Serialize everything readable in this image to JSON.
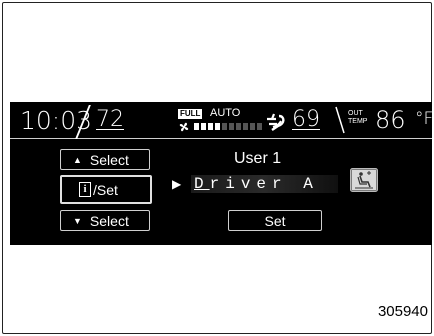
{
  "status_bar": {
    "clock": "10:03",
    "left_temp": "72",
    "fan_mode_badge": "FULL",
    "fan_auto_label": "AUTO",
    "fan_level_fraction": 0.4,
    "right_temp": "69",
    "outside_label_line1": "OUT",
    "outside_label_line2": "TEMP",
    "outside_temp": "86",
    "outside_unit": "°F",
    "icons": [
      "fan-icon",
      "airflow-icon"
    ]
  },
  "controls": {
    "select_up_label": "Select",
    "info_set_icon": "i",
    "info_set_label": "/Set",
    "select_down_label": "Select",
    "arrow_up": "▲",
    "arrow_down": "▼"
  },
  "main": {
    "user_title": "User 1",
    "driver_arrow": "▶",
    "driver_name": "Driver A",
    "set_label": "Set",
    "seat_icon": "seat-position-icon"
  },
  "figure_code": "305940",
  "colors": {
    "screen_bg": "#000000",
    "text": "#ffffff",
    "border": "#cfcfcf"
  }
}
